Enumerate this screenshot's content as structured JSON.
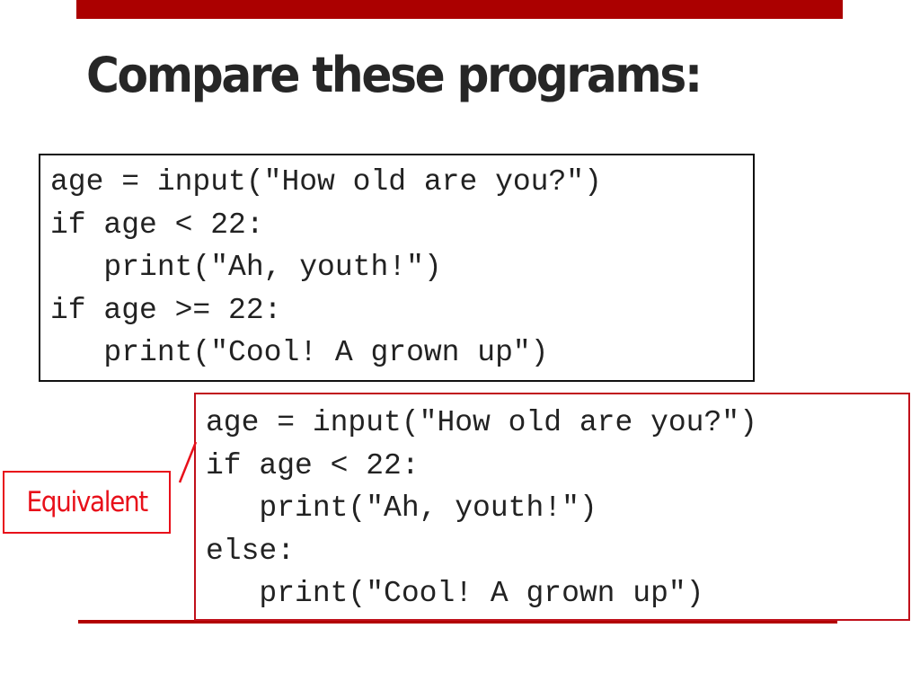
{
  "slide": {
    "title": "Compare these programs:",
    "program1": {
      "lines": [
        "age = input(\"How old are you?\")",
        "if age < 22:",
        "   print(\"Ah, youth!\")",
        "if age >= 22:",
        "   print(\"Cool! A grown up\")"
      ]
    },
    "program2": {
      "lines": [
        "age = input(\"How old are you?\")",
        "if age < 22:",
        "   print(\"Ah, youth!\")",
        "else:",
        "   print(\"Cool! A grown up\")"
      ]
    },
    "callout": {
      "label": "Equivalent"
    }
  },
  "colors": {
    "accent_bar": "#ab0000",
    "callout_red": "#e8101a",
    "box2_border": "#c0101a",
    "title_text": "#262626"
  }
}
